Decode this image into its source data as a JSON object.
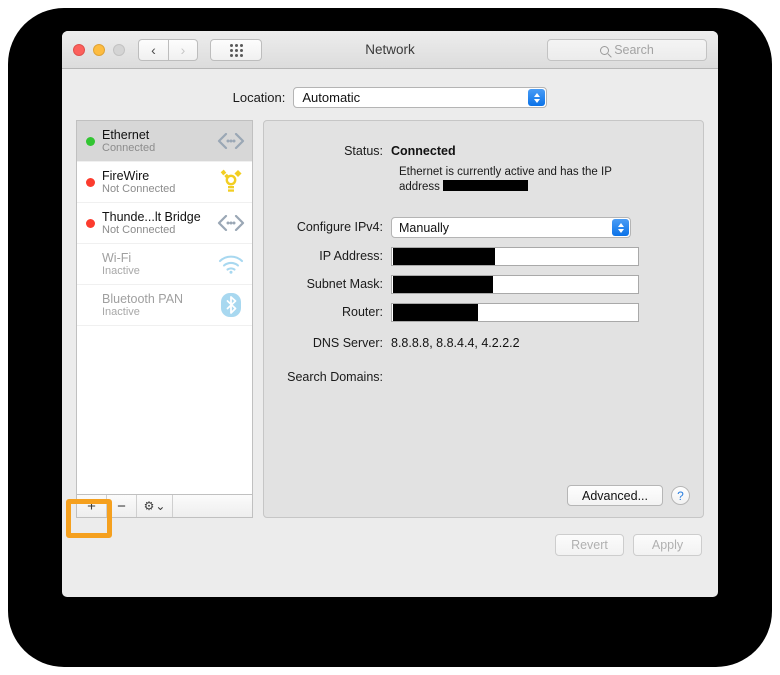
{
  "window": {
    "title": "Network",
    "traffic_lights": [
      "close",
      "minimize",
      "maximize"
    ],
    "nav_back": "‹",
    "nav_forward": "›",
    "grid_button": "show-all-grid"
  },
  "search": {
    "placeholder": "Search",
    "value": ""
  },
  "location": {
    "label": "Location:",
    "selected": "Automatic"
  },
  "sidebar": {
    "interfaces": [
      {
        "name": "Ethernet",
        "state": "Connected",
        "dot": "green",
        "icon": "ethernet-icon",
        "selected": true,
        "inactive": false
      },
      {
        "name": "FireWire",
        "state": "Not Connected",
        "dot": "red",
        "icon": "firewire-icon",
        "selected": false,
        "inactive": false
      },
      {
        "name": "Thunde...lt Bridge",
        "state": "Not Connected",
        "dot": "red",
        "icon": "ethernet-icon",
        "selected": false,
        "inactive": false
      },
      {
        "name": "Wi-Fi",
        "state": "Inactive",
        "dot": "none",
        "icon": "wifi-icon",
        "selected": false,
        "inactive": true
      },
      {
        "name": "Bluetooth PAN",
        "state": "Inactive",
        "dot": "none",
        "icon": "bluetooth-icon",
        "selected": false,
        "inactive": true
      }
    ],
    "toolbar": {
      "add": "+",
      "remove": "−",
      "gear": "⚙",
      "gear_chevron": "⌄"
    }
  },
  "main": {
    "status_label": "Status:",
    "status_value": "Connected",
    "status_description_pre": "Ethernet is currently active and has the IP",
    "status_description_post": "address",
    "status_redacted": true,
    "configure_label": "Configure IPv4:",
    "configure_value": "Manually",
    "ip_label": "IP Address:",
    "ip_value": "",
    "ip_redacted": true,
    "subnet_label": "Subnet Mask:",
    "subnet_value": "",
    "subnet_redacted": true,
    "router_label": "Router:",
    "router_value": "",
    "router_redacted": true,
    "dns_label": "DNS Server:",
    "dns_value": "8.8.8.8, 8.8.4.4, 4.2.2.2",
    "search_domains_label": "Search Domains:",
    "search_domains_value": "",
    "advanced_label": "Advanced...",
    "help_label": "?"
  },
  "footer": {
    "revert_label": "Revert",
    "apply_label": "Apply",
    "revert_enabled": false,
    "apply_enabled": false
  },
  "annotation": {
    "highlight_target": "add-interface-button",
    "highlight_color": "#f5a01e"
  }
}
